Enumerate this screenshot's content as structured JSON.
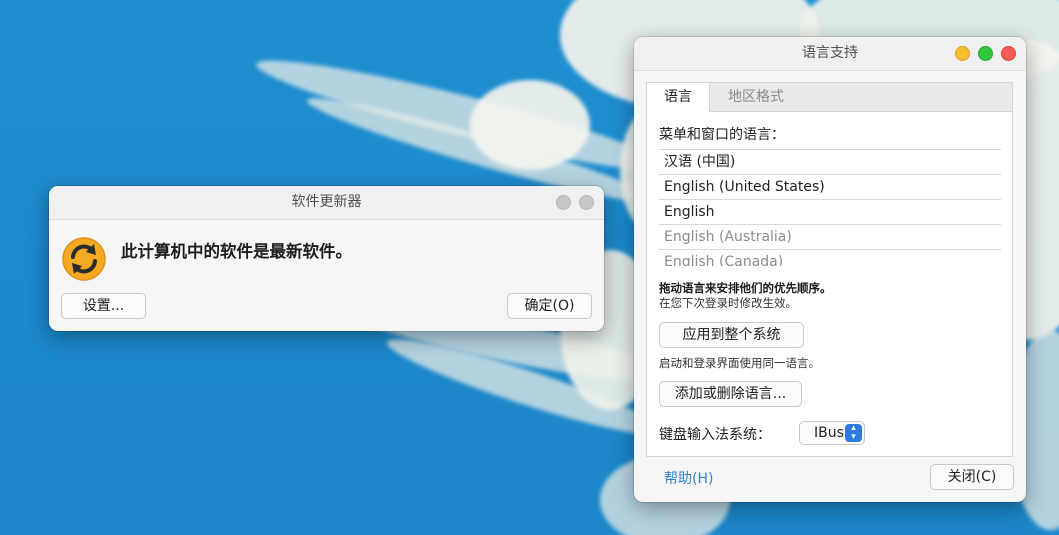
{
  "updater": {
    "title": "软件更新器",
    "message": "此计算机中的软件是最新软件。",
    "settings_button": "设置...",
    "ok_button": "确定(O)"
  },
  "language_support": {
    "title": "语言支持",
    "tabs": [
      {
        "label": "语言"
      },
      {
        "label": "地区格式"
      }
    ],
    "menu_language_label": "菜单和窗口的语言：",
    "languages": [
      {
        "label": "汉语 (中国)"
      },
      {
        "label": "English (United States)"
      },
      {
        "label": "English"
      },
      {
        "label": "English (Australia)"
      },
      {
        "label": "English (Canada)"
      }
    ],
    "drag_hint": "拖动语言来安排他们的优先顺序。",
    "next_login_hint": "在您下次登录时修改生效。",
    "apply_button": "应用到整个系统",
    "login_screen_hint": "启动和登录界面使用同一语言。",
    "add_remove_button": "添加或删除语言...",
    "im_label": "键盘输入法系统：",
    "im_value": "IBus",
    "help_link": "帮助(H)",
    "close_button": "关闭(C)"
  },
  "colors": {
    "desktop_blue": "#1f8fd0",
    "accent_blue": "#2c7de0",
    "link_blue": "#2f7fd3",
    "traffic_yellow": "#f7be2f",
    "traffic_green": "#2fc83f",
    "traffic_red": "#f65c55",
    "updater_icon": "#f4a923"
  }
}
